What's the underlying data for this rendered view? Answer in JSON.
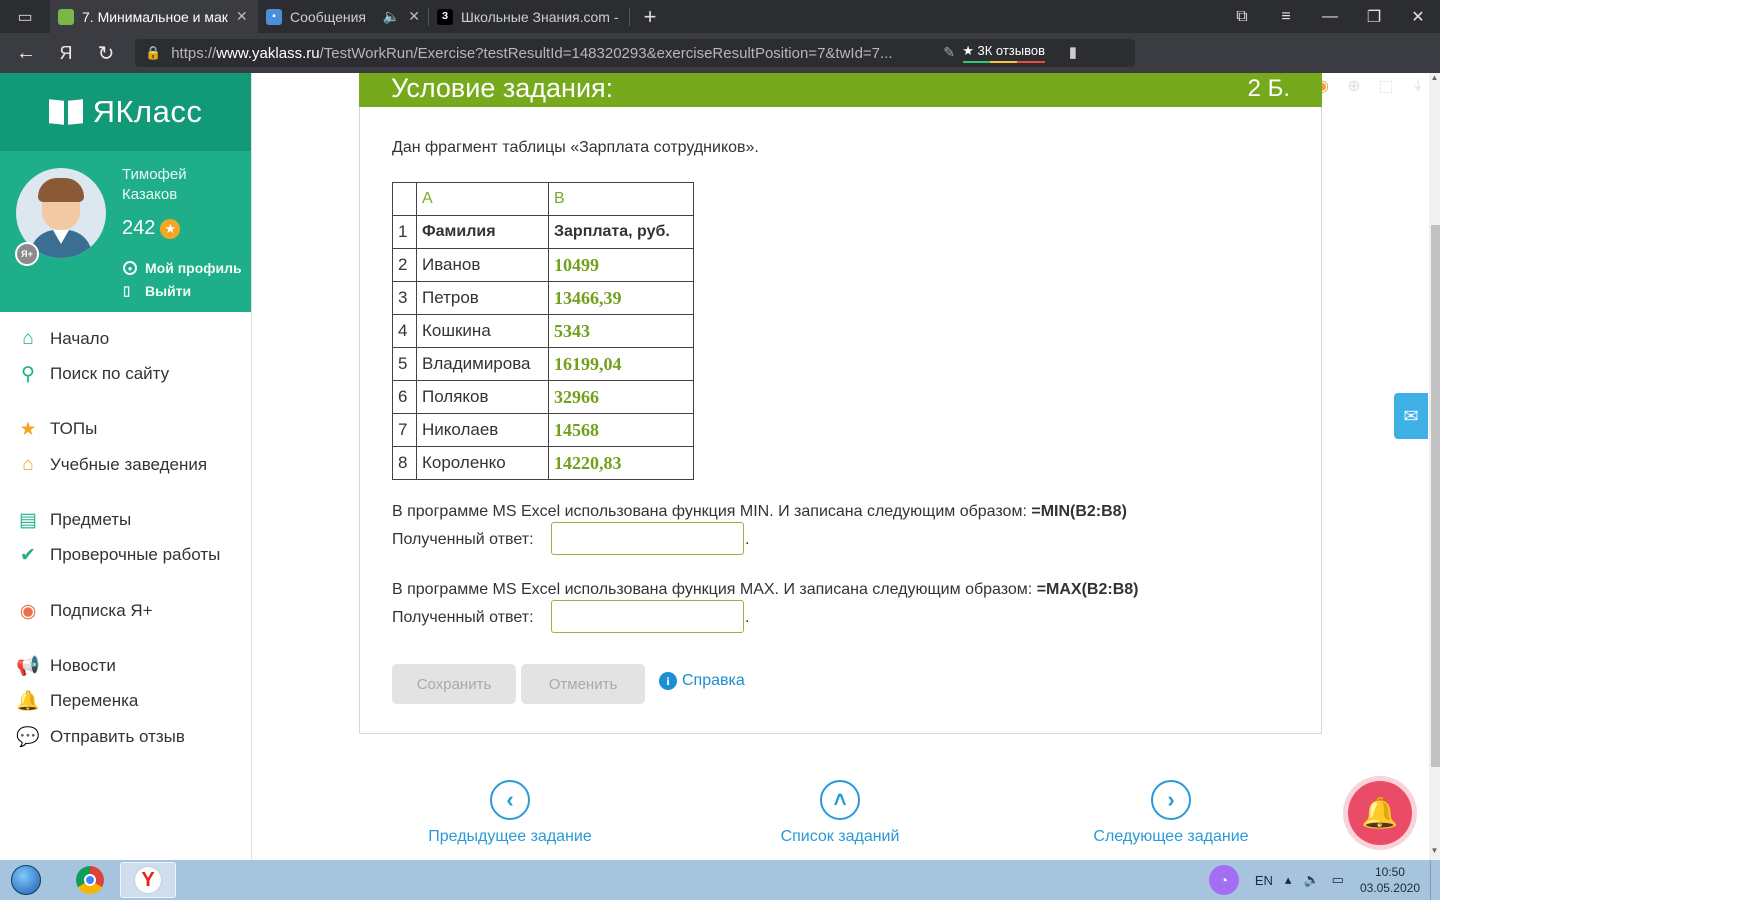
{
  "browser": {
    "tabs": [
      {
        "title": "7. Минимальное и мак",
        "favicon": "green-book",
        "active": true
      },
      {
        "title": "Сообщения",
        "favicon": "chat-bubble",
        "active": false
      },
      {
        "title": "Школьные Знания.com - ",
        "favicon": "znanija-z",
        "active": false
      }
    ],
    "url_prefix": "https://",
    "url_domain": "www.yaklass.ru",
    "url_rest": "/TestWorkRun/Exercise?testResultId=148320293&exerciseResultPosition=7&twId=7...",
    "reviews_label": "★ 3К отзывов"
  },
  "sidebar": {
    "brand": "ЯКласс",
    "user": {
      "first_name": "Тимофей",
      "last_name": "Казаков",
      "points": "242",
      "profile_link": "Мой профиль",
      "logout_link": "Выйти",
      "badge": "Я+"
    },
    "menu": [
      {
        "label": "Начало",
        "icon": "home-icon",
        "color": "#1eae8a"
      },
      {
        "label": "Поиск по сайту",
        "icon": "search-icon",
        "color": "#1eae8a"
      },
      {
        "label": "ТОПы",
        "icon": "star-icon",
        "color": "#f5a623"
      },
      {
        "label": "Учебные заведения",
        "icon": "school-icon",
        "color": "#f5a623"
      },
      {
        "label": "Предметы",
        "icon": "books-icon",
        "color": "#1eae8a"
      },
      {
        "label": "Проверочные работы",
        "icon": "check-circle-icon",
        "color": "#1eae8a"
      },
      {
        "label": "Подписка Я+",
        "icon": "ya-plus-icon",
        "color": "#e8734a"
      },
      {
        "label": "Новости",
        "icon": "megaphone-icon",
        "color": "#4a6274"
      },
      {
        "label": "Переменка",
        "icon": "bell-icon",
        "color": "#4a6274"
      },
      {
        "label": "Отправить отзыв",
        "icon": "comment-icon",
        "color": "#4a6274"
      }
    ]
  },
  "task": {
    "header_title": "Условие задания:",
    "points": "2 Б.",
    "intro": "Дан фрагмент таблицы «Зарплата сотрудников».",
    "table": {
      "col_headers": [
        "A",
        "B"
      ],
      "header_row": {
        "num": "1",
        "a": "Фамилия",
        "b": "Зарплата, руб."
      },
      "rows": [
        {
          "num": "2",
          "a": "Иванов",
          "b": "10499"
        },
        {
          "num": "3",
          "a": "Петров",
          "b": "13466,39"
        },
        {
          "num": "4",
          "a": "Кошкина",
          "b": "5343"
        },
        {
          "num": "5",
          "a": "Владимирова",
          "b": "16199,04"
        },
        {
          "num": "6",
          "a": "Поляков",
          "b": "32966"
        },
        {
          "num": "7",
          "a": "Николаев",
          "b": "14568"
        },
        {
          "num": "8",
          "a": "Короленко",
          "b": "14220,83"
        }
      ]
    },
    "q1_text": "В программе MS Excel  использована функция MIN. И записана следующим образом: ",
    "q1_formula": "=MIN(B2:B8)",
    "q2_text": "В программе MS Excel  использована функция MAX. И записана следующим образом: ",
    "q2_formula": "=MAX(B2:B8)",
    "answer_label": "Полученный ответ:",
    "answer1_value": "",
    "answer2_value": "",
    "dot": ".",
    "save_button": "Сохранить",
    "cancel_button": "Отменить",
    "help_link": "Справка"
  },
  "navigation": {
    "prev": "Предыдущее задание",
    "list": "Список заданий",
    "next": "Следующее задание"
  },
  "taskbar": {
    "lang": "EN",
    "time": "10:50",
    "date": "03.05.2020"
  },
  "colors": {
    "brand_green": "#1eae8a",
    "header_green": "#76a91b",
    "link_blue": "#2a9ad6"
  }
}
